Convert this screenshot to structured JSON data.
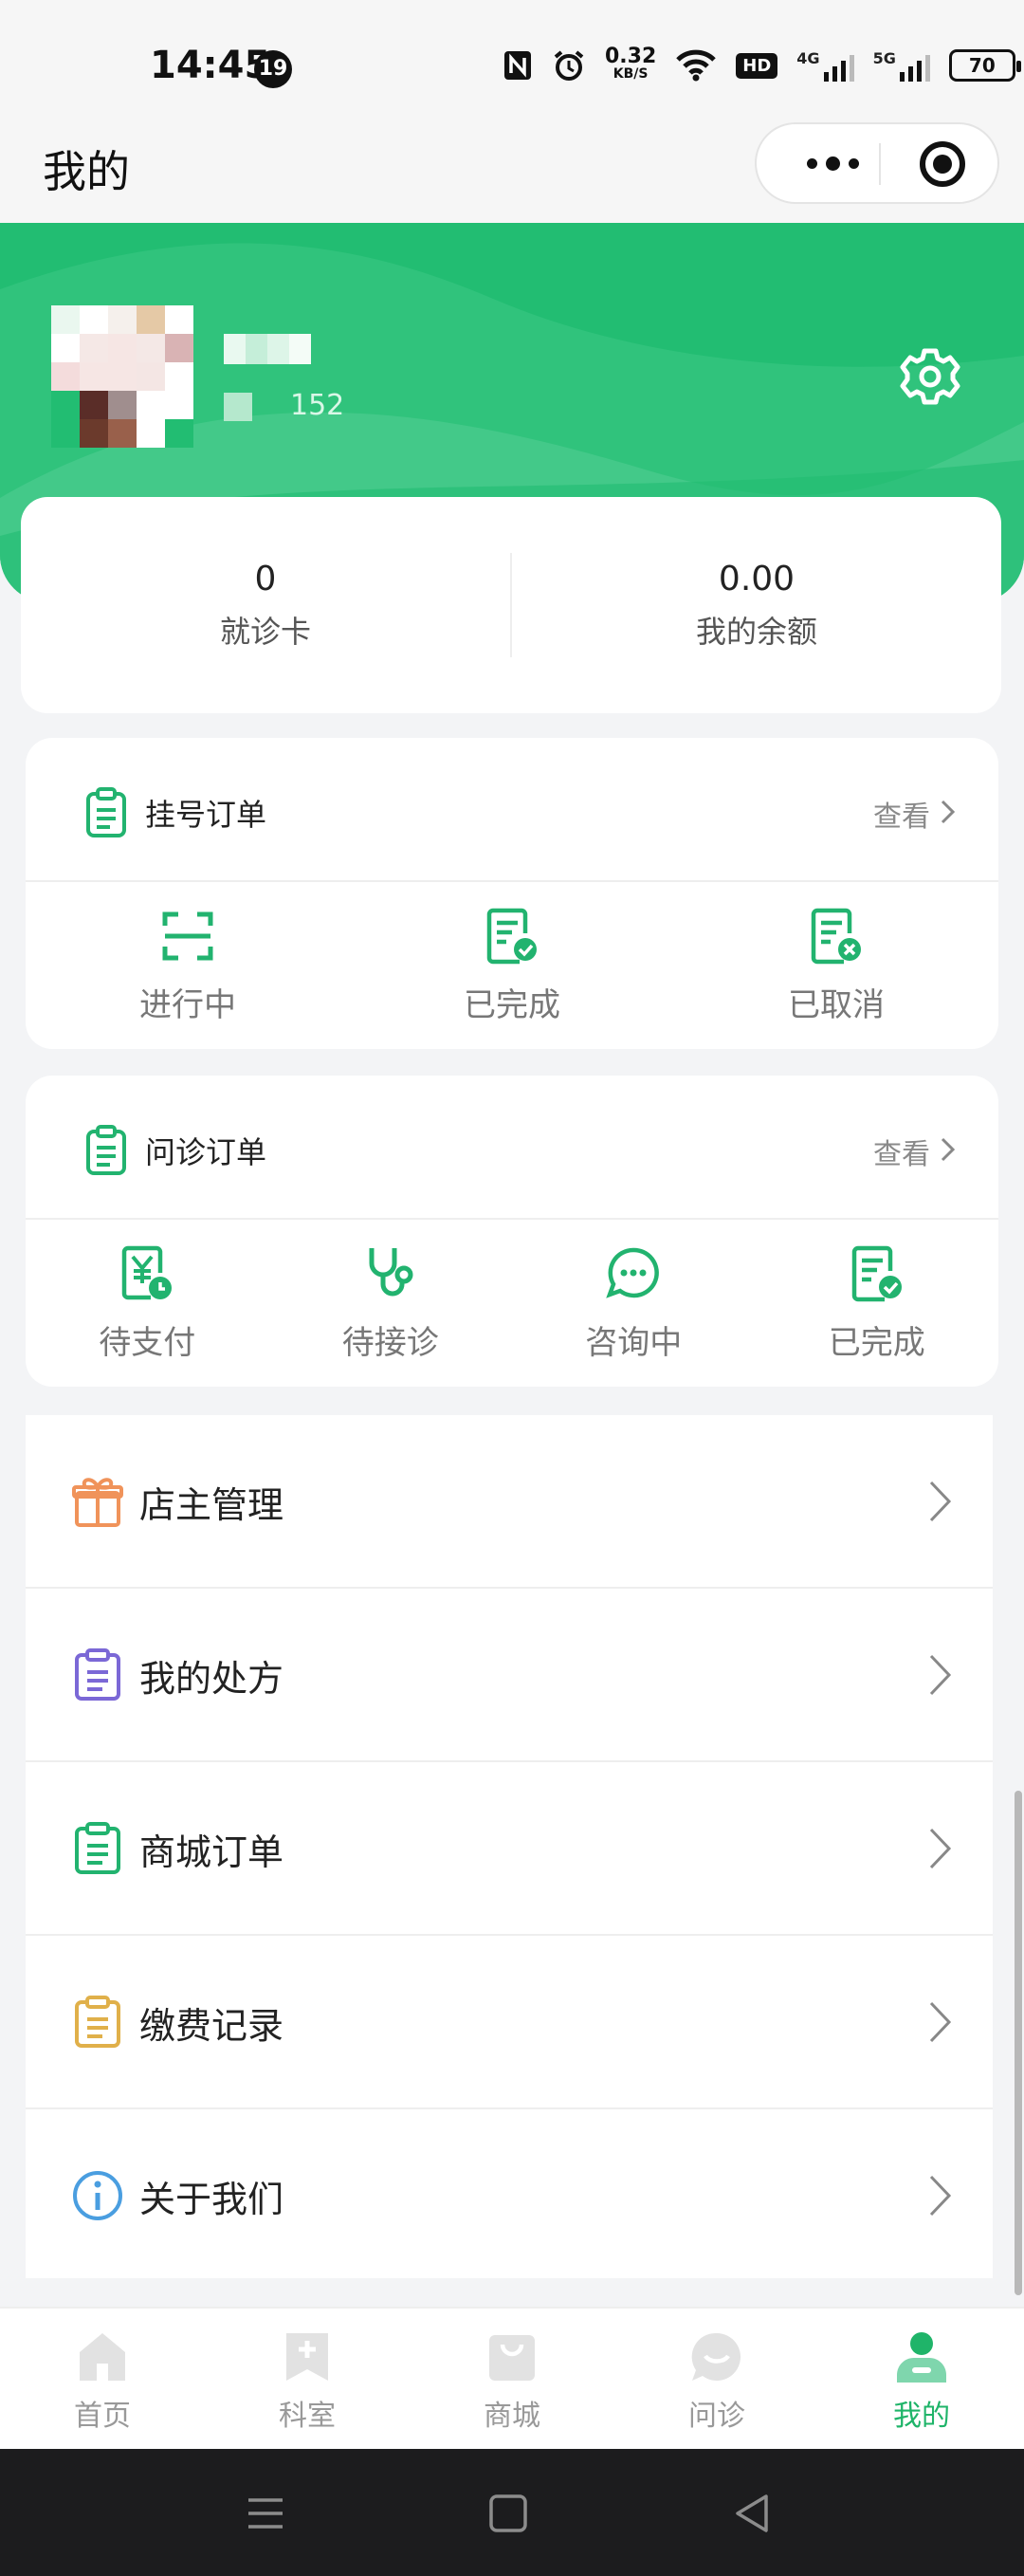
{
  "status_bar": {
    "time": "14:45",
    "notification_count": "19",
    "net_speed_value": "0.32",
    "net_speed_unit": "KB/S",
    "hd_label": "HD",
    "signal1_label": "4G",
    "signal2_label": "5G",
    "battery": "70"
  },
  "header": {
    "title": "我的"
  },
  "profile": {
    "phone_tail": "152"
  },
  "stats": [
    {
      "value": "0",
      "label": "就诊卡"
    },
    {
      "value": "0.00",
      "label": "我的余额"
    }
  ],
  "registration_orders": {
    "title": "挂号订单",
    "more": "查看",
    "items": [
      {
        "label": "进行中",
        "icon": "scan-icon"
      },
      {
        "label": "已完成",
        "icon": "doc-check-icon"
      },
      {
        "label": "已取消",
        "icon": "doc-cancel-icon"
      }
    ]
  },
  "consult_orders": {
    "title": "问诊订单",
    "more": "查看",
    "items": [
      {
        "label": "待支付",
        "icon": "pay-icon"
      },
      {
        "label": "待接诊",
        "icon": "stethoscope-icon"
      },
      {
        "label": "咨询中",
        "icon": "chat-icon"
      },
      {
        "label": "已完成",
        "icon": "doc-check-icon"
      }
    ]
  },
  "menu": [
    {
      "label": "店主管理",
      "icon": "gift-icon",
      "color": "#f0935a"
    },
    {
      "label": "我的处方",
      "icon": "clipboard-icon",
      "color": "#7b68d6"
    },
    {
      "label": "商城订单",
      "icon": "clipboard-icon",
      "color": "#22b36f"
    },
    {
      "label": "缴费记录",
      "icon": "clipboard-icon",
      "color": "#e0b04a"
    },
    {
      "label": "关于我们",
      "icon": "info-icon",
      "color": "#4a9ee0"
    }
  ],
  "tabbar": [
    {
      "label": "首页",
      "icon": "home-icon"
    },
    {
      "label": "科室",
      "icon": "bookmark-plus-icon"
    },
    {
      "label": "商城",
      "icon": "shopping-bag-icon"
    },
    {
      "label": "问诊",
      "icon": "chat-smile-icon"
    },
    {
      "label": "我的",
      "icon": "user-icon",
      "active": true
    }
  ],
  "colors": {
    "brand": "#22bd72",
    "tab_active": "#1fb469",
    "tab_inactive": "#d6d6d6"
  }
}
